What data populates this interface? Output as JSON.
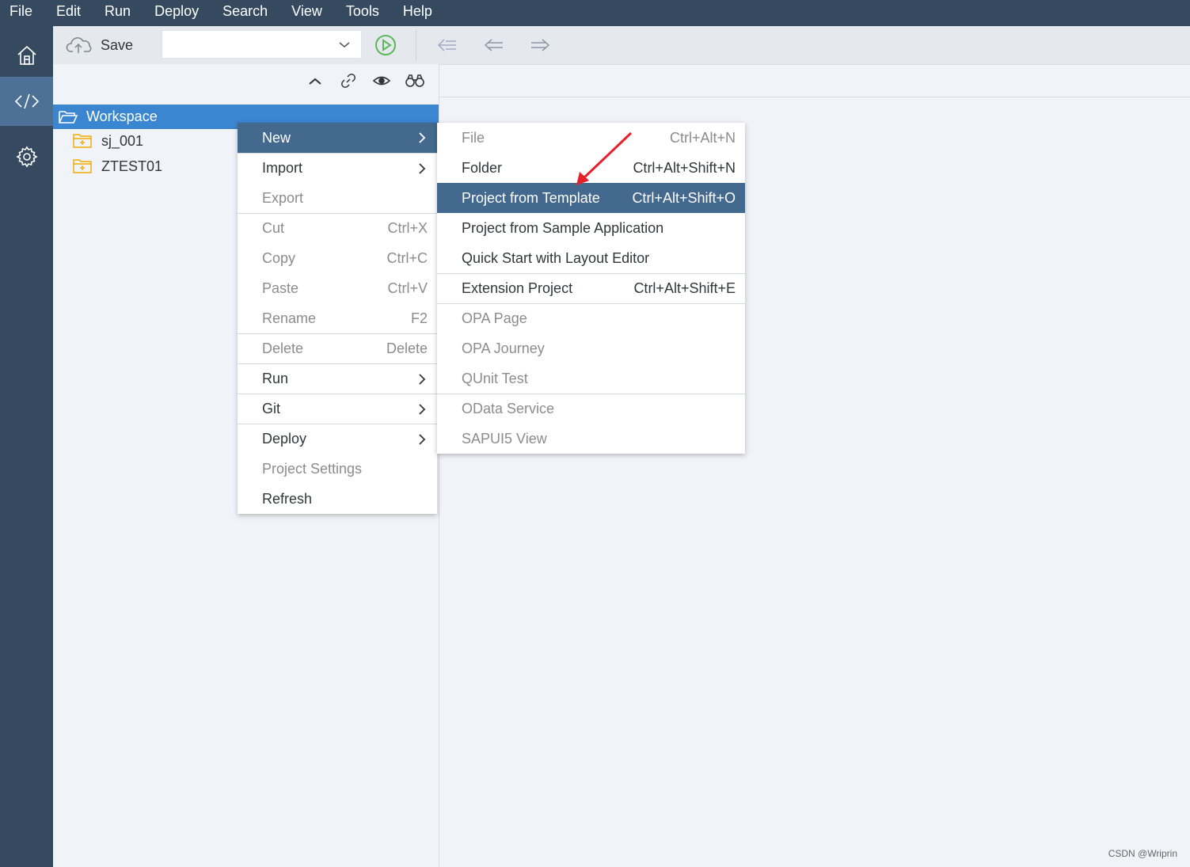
{
  "menubar": [
    "File",
    "Edit",
    "Run",
    "Deploy",
    "Search",
    "View",
    "Tools",
    "Help"
  ],
  "toolbar": {
    "save_label": "Save",
    "run_config_value": ""
  },
  "workspace": {
    "root_label": "Workspace",
    "items": [
      {
        "label": "sj_001"
      },
      {
        "label": "ZTEST01"
      }
    ]
  },
  "context_menu": [
    {
      "label": "New",
      "shortcut": "",
      "submenu": true,
      "disabled": false,
      "selected": true,
      "sep": false
    },
    {
      "label": "Import",
      "shortcut": "",
      "submenu": true,
      "disabled": false,
      "selected": false,
      "sep": true
    },
    {
      "label": "Export",
      "shortcut": "",
      "submenu": false,
      "disabled": true,
      "selected": false,
      "sep": false
    },
    {
      "label": "Cut",
      "shortcut": "Ctrl+X",
      "submenu": false,
      "disabled": true,
      "selected": false,
      "sep": true
    },
    {
      "label": "Copy",
      "shortcut": "Ctrl+C",
      "submenu": false,
      "disabled": true,
      "selected": false,
      "sep": false
    },
    {
      "label": "Paste",
      "shortcut": "Ctrl+V",
      "submenu": false,
      "disabled": true,
      "selected": false,
      "sep": false
    },
    {
      "label": "Rename",
      "shortcut": "F2",
      "submenu": false,
      "disabled": true,
      "selected": false,
      "sep": false
    },
    {
      "label": "Delete",
      "shortcut": "Delete",
      "submenu": false,
      "disabled": true,
      "selected": false,
      "sep": true
    },
    {
      "label": "Run",
      "shortcut": "",
      "submenu": true,
      "disabled": false,
      "selected": false,
      "sep": true
    },
    {
      "label": "Git",
      "shortcut": "",
      "submenu": true,
      "disabled": false,
      "selected": false,
      "sep": true
    },
    {
      "label": "Deploy",
      "shortcut": "",
      "submenu": true,
      "disabled": false,
      "selected": false,
      "sep": true
    },
    {
      "label": "Project Settings",
      "shortcut": "",
      "submenu": false,
      "disabled": true,
      "selected": false,
      "sep": false
    },
    {
      "label": "Refresh",
      "shortcut": "",
      "submenu": false,
      "disabled": false,
      "selected": false,
      "sep": false
    }
  ],
  "new_submenu": [
    {
      "label": "File",
      "shortcut": "Ctrl+Alt+N",
      "disabled": true,
      "selected": false,
      "sep": false
    },
    {
      "label": "Folder",
      "shortcut": "Ctrl+Alt+Shift+N",
      "disabled": false,
      "selected": false,
      "sep": false
    },
    {
      "label": "Project from Template",
      "shortcut": "Ctrl+Alt+Shift+O",
      "disabled": false,
      "selected": true,
      "sep": false
    },
    {
      "label": "Project from Sample Application",
      "shortcut": "",
      "disabled": false,
      "selected": false,
      "sep": false
    },
    {
      "label": "Quick Start with Layout Editor",
      "shortcut": "",
      "disabled": false,
      "selected": false,
      "sep": false
    },
    {
      "label": "Extension Project",
      "shortcut": "Ctrl+Alt+Shift+E",
      "disabled": false,
      "selected": false,
      "sep": true
    },
    {
      "label": "OPA Page",
      "shortcut": "",
      "disabled": true,
      "selected": false,
      "sep": true
    },
    {
      "label": "OPA Journey",
      "shortcut": "",
      "disabled": true,
      "selected": false,
      "sep": false
    },
    {
      "label": "QUnit Test",
      "shortcut": "",
      "disabled": true,
      "selected": false,
      "sep": false
    },
    {
      "label": "OData Service",
      "shortcut": "",
      "disabled": true,
      "selected": false,
      "sep": true
    },
    {
      "label": "SAPUI5 View",
      "shortcut": "",
      "disabled": true,
      "selected": false,
      "sep": false
    }
  ],
  "watermark": "CSDN @Wriprin",
  "colors": {
    "menubar": "#354a5f",
    "selection": "#44698e",
    "tree_selected": "#3b86d0",
    "folder": "#f0ab00",
    "run_green": "#5cb85c"
  }
}
